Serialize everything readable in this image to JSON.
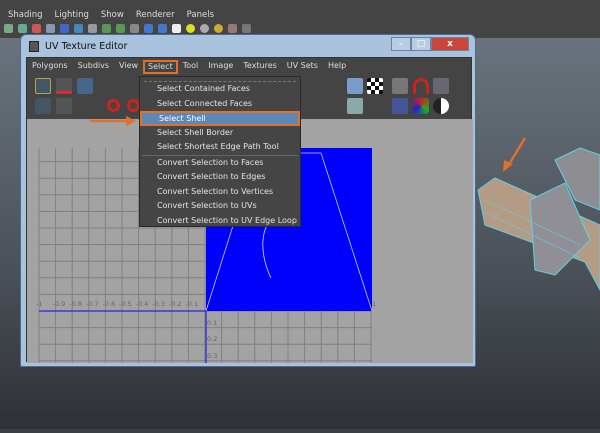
{
  "maya_menu": [
    "Shading",
    "Lighting",
    "Show",
    "Renderer",
    "Panels"
  ],
  "window": {
    "title": "UV Texture Editor",
    "buttons": {
      "minimize": "–",
      "maximize": "□",
      "close": "x"
    }
  },
  "menubar": [
    "Polygons",
    "Subdivs",
    "View",
    "Select",
    "Tool",
    "Image",
    "Textures",
    "UV Sets",
    "Help"
  ],
  "select_menu": {
    "items": [
      "Select Contained Faces",
      "Select Connected Faces",
      "Select Shell",
      "Select Shell Border",
      "Select Shortest Edge Path Tool",
      "Convert Selection to Faces",
      "Convert Selection to Edges",
      "Convert Selection to Vertices",
      "Convert Selection to UVs",
      "Convert Selection to UV Edge Loop"
    ],
    "highlighted": "Select Shell"
  },
  "uv_axis": {
    "x_labels": [
      "-1",
      "-0.9",
      "-0.8",
      "-0.7",
      "-0.6",
      "-0.5",
      "-0.4",
      "-0.3",
      "-0.2",
      "-0.1",
      "1"
    ],
    "y_labels": [
      "0.1",
      "0.2",
      "0.3"
    ]
  },
  "colors": {
    "accent": "#e0702a",
    "uv_tile": "#0000ff",
    "highlight": "#5d87b5",
    "wire": "#5fd3e8"
  }
}
